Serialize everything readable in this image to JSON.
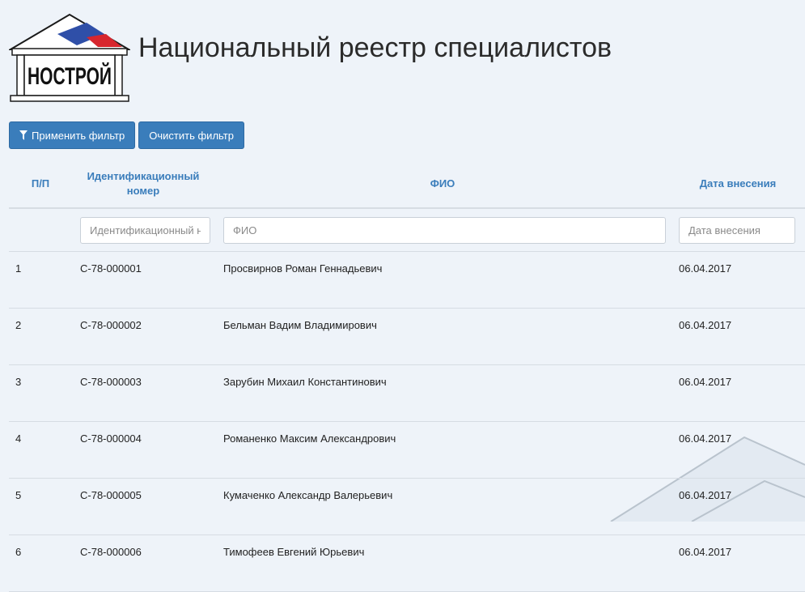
{
  "header": {
    "logo_text": "НОСТРОЙ",
    "title": "Национальный реестр специалистов"
  },
  "toolbar": {
    "apply_filter_label": "Применить фильтр",
    "clear_filter_label": "Очистить фильтр",
    "apply_icon": "filter-icon",
    "button_color": "#3a7dbb"
  },
  "table": {
    "columns": {
      "num": "П/П",
      "id": "Идентификационный номер",
      "fio": "ФИО",
      "date": "Дата внесения"
    },
    "filters": {
      "id_placeholder": "Идентификационный номер",
      "fio_placeholder": "ФИО",
      "date_placeholder": "Дата внесения"
    },
    "rows": [
      {
        "num": "1",
        "id": "С-78-000001",
        "fio": "Просвирнов Роман Геннадьевич",
        "date": "06.04.2017"
      },
      {
        "num": "2",
        "id": "С-78-000002",
        "fio": "Бельман Вадим Владимирович",
        "date": "06.04.2017"
      },
      {
        "num": "3",
        "id": "С-78-000003",
        "fio": "Зарубин Михаил Константинович",
        "date": "06.04.2017"
      },
      {
        "num": "4",
        "id": "С-78-000004",
        "fio": "Романенко Максим Александрович",
        "date": "06.04.2017"
      },
      {
        "num": "5",
        "id": "С-78-000005",
        "fio": "Кумаченко Александр Валерьевич",
        "date": "06.04.2017"
      },
      {
        "num": "6",
        "id": "С-78-000006",
        "fio": "Тимофеев Евгений Юрьевич",
        "date": "06.04.2017"
      }
    ]
  }
}
